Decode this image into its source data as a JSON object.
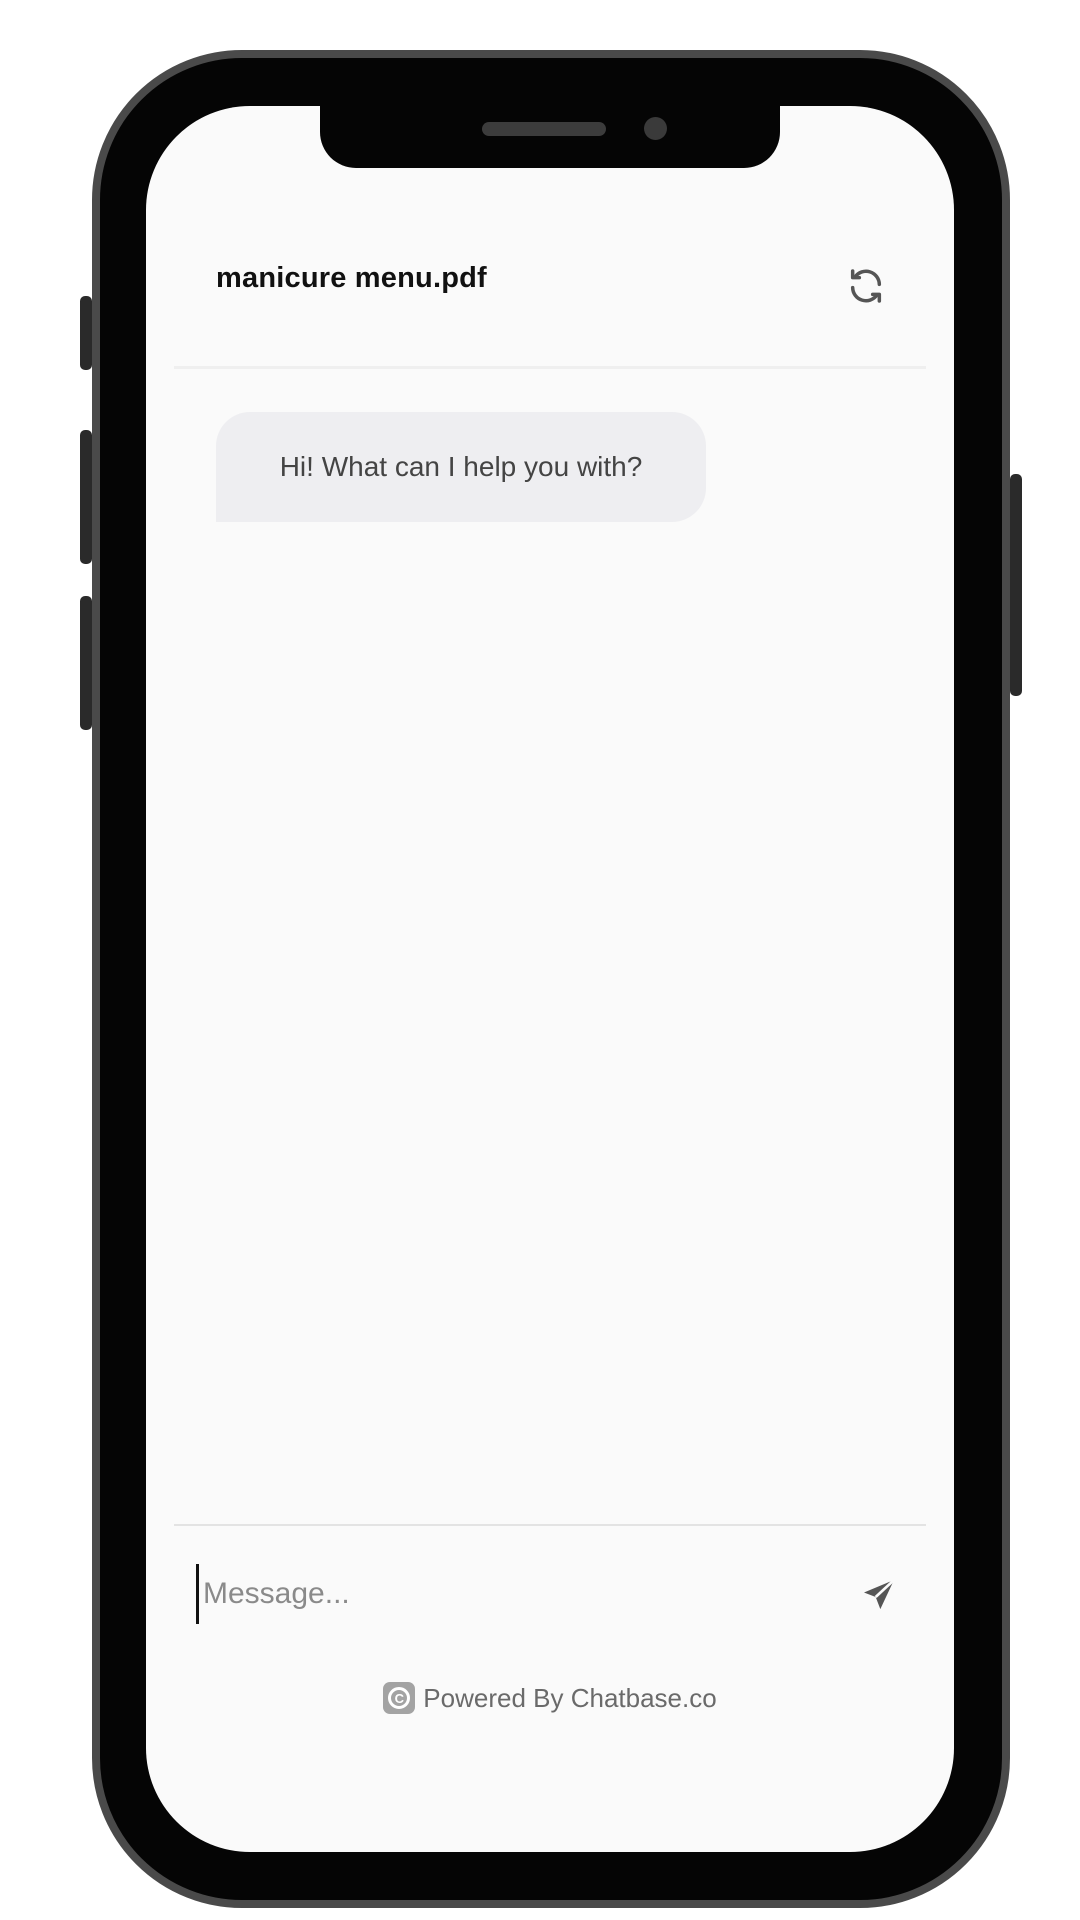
{
  "chat": {
    "title": "manicure menu.pdf",
    "refresh_icon": "refresh-icon"
  },
  "messages": [
    {
      "role": "assistant",
      "text": "Hi! What can I help you with?"
    }
  ],
  "composer": {
    "placeholder": "Message...",
    "value": "",
    "send_icon": "send-icon"
  },
  "footer": {
    "logo_letter": "C",
    "text": "Powered By Chatbase.co"
  },
  "colors": {
    "screen_bg": "#fafafa",
    "bubble_bg": "#eeeef1",
    "phone_frame": "#4a4a4a",
    "icon_color": "#555555"
  }
}
